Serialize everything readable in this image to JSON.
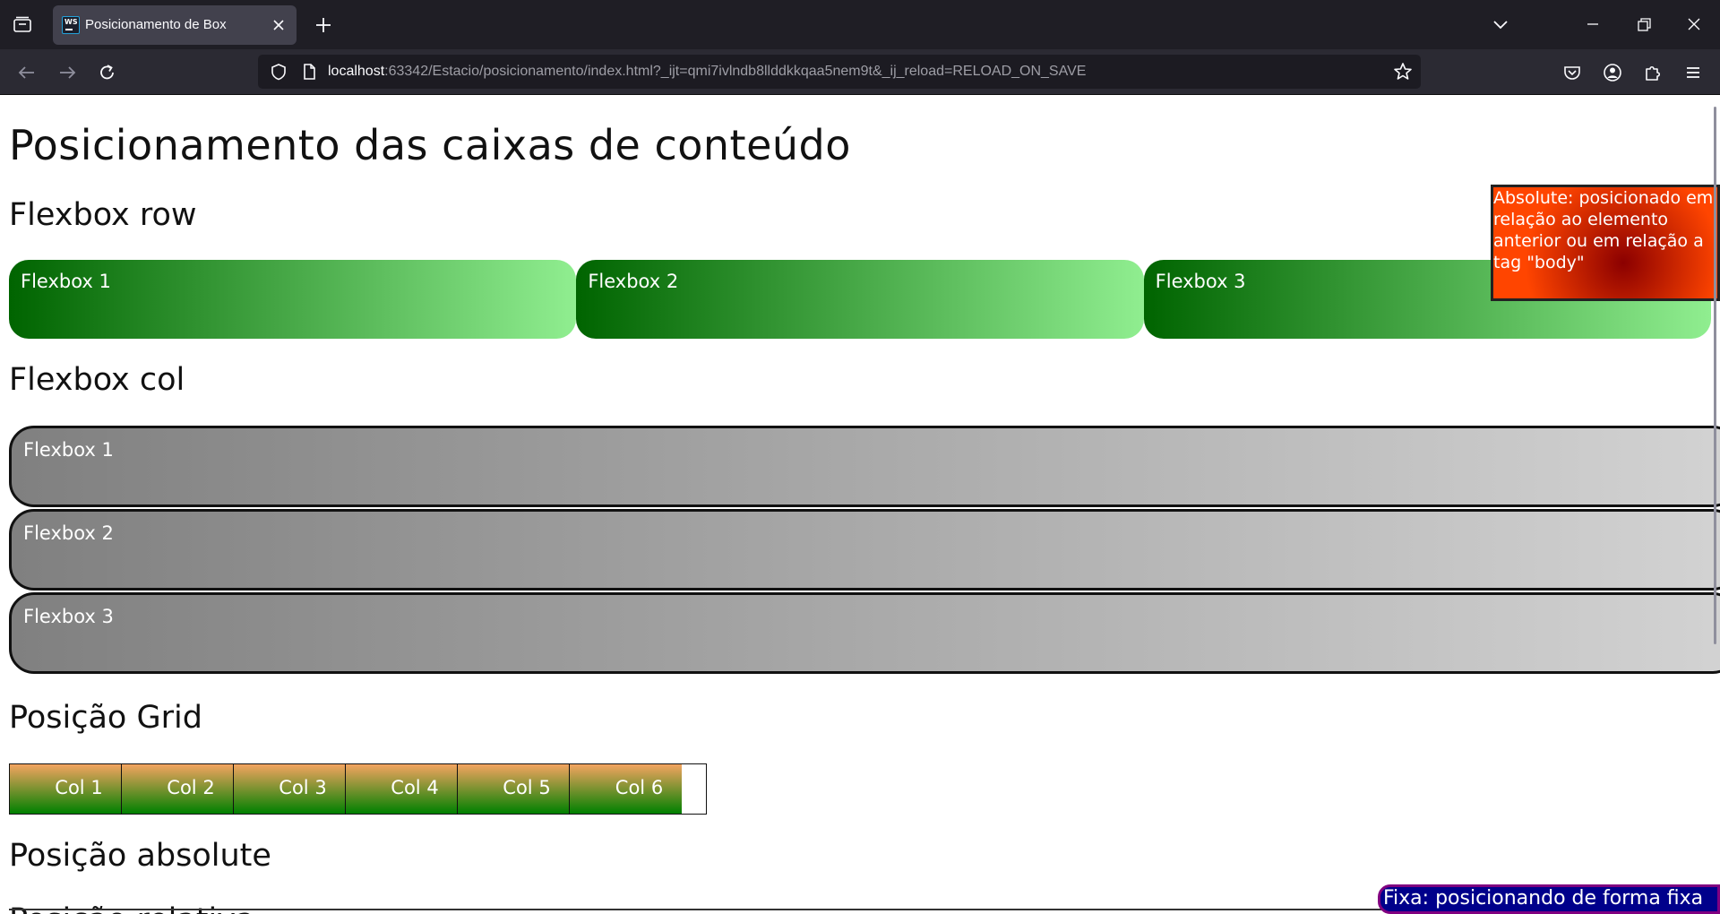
{
  "browser": {
    "tab": {
      "title": "Posicionamento de Box",
      "favicon_text": "WS"
    },
    "url": {
      "host": "localhost",
      "rest": ":63342/Estacio/posicionamento/index.html?_ijt=qmi7ivlndb8llddkkqaa5nem9t&_ij_reload=RELOAD_ON_SAVE"
    },
    "icons": {
      "tab_list": "tab-list-icon",
      "close_tab": "close-icon",
      "new_tab": "plus-icon",
      "list_all_tabs": "chevron-down-icon",
      "minimize": "minimize-icon",
      "restore": "restore-icon",
      "close_window": "close-window-icon",
      "back": "back-arrow-icon",
      "forward": "forward-arrow-icon",
      "reload": "reload-icon",
      "tracking_protection": "shield-icon",
      "page_info": "page-icon",
      "bookmark": "star-icon",
      "pocket": "pocket-icon",
      "account": "account-icon",
      "extensions": "puzzle-icon",
      "menu": "hamburger-menu-icon"
    }
  },
  "page": {
    "title": "Posicionamento das caixas de conteúdo",
    "flex_row": {
      "heading": "Flexbox row",
      "items": [
        "Flexbox 1",
        "Flexbox 2",
        "Flexbox 3"
      ]
    },
    "flex_col": {
      "heading": "Flexbox col",
      "items": [
        "Flexbox 1",
        "Flexbox 2",
        "Flexbox 3"
      ]
    },
    "grid": {
      "heading": "Posição Grid",
      "cells": [
        "Col 1",
        "Col 2",
        "Col 3",
        "Col 4",
        "Col 5",
        "Col 6"
      ]
    },
    "absolute": {
      "heading": "Posição absolute",
      "box_text": "Absolute: posicionado em relação ao elemento anterior ou em relação a tag \"body\""
    },
    "relative": {
      "heading_partial": "Posição relativa"
    },
    "fixed": {
      "box_text": "Fixa: posicionando de forma fixa"
    }
  },
  "colors": {
    "row_gradient": [
      "#006400",
      "#90ee90"
    ],
    "col_gradient": [
      "#808080",
      "#d3d3d3"
    ],
    "grid_gradient": [
      "#f4a460",
      "#008000"
    ],
    "absolute_gradient": [
      "#8b0000",
      "#ff4500"
    ],
    "fixed_bg": "#00008b",
    "fixed_border": "#800080"
  }
}
